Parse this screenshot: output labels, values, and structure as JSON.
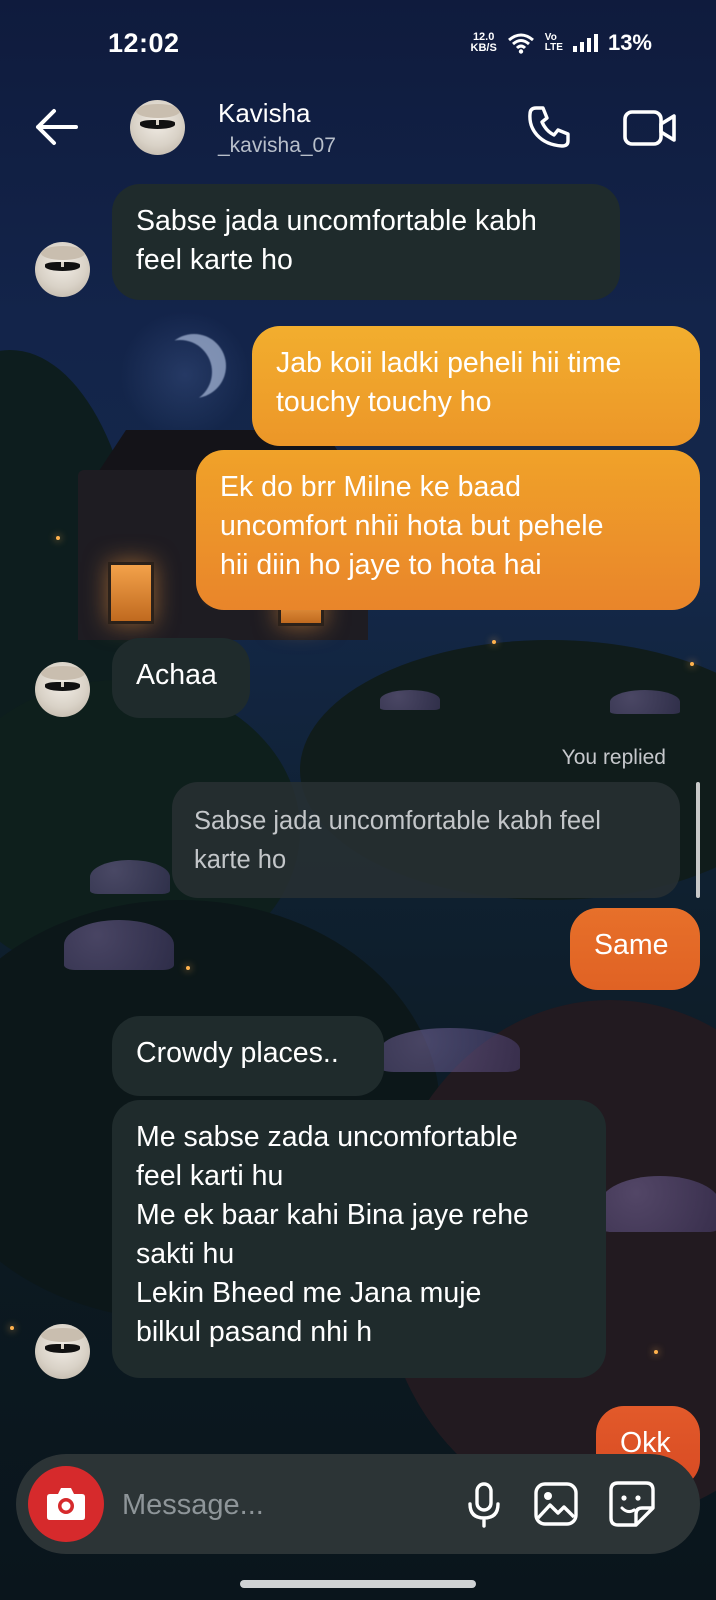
{
  "status_bar": {
    "time": "12:02",
    "net_speed_value": "12.0",
    "net_speed_unit": "KB/S",
    "volte_top": "Vo",
    "volte_bottom": "LTE",
    "battery": "13%"
  },
  "header": {
    "name": "Kavisha",
    "username": "_kavisha_07"
  },
  "messages": [
    {
      "from": "them",
      "text": "Sabse jada uncomfortable kabh\nfeel karte ho"
    },
    {
      "from": "me",
      "text": "Jab koii ladki peheli hii time\ntouchy touchy ho"
    },
    {
      "from": "me",
      "text": "Ek do brr Milne ke baad\nuncomfort nhii hota but pehele\nhii diin ho jaye to  hota hai"
    },
    {
      "from": "them",
      "text": "Achaa"
    },
    {
      "from": "me",
      "text": "Same"
    },
    {
      "from": "them",
      "text": "Crowdy places.."
    },
    {
      "from": "them",
      "text": "Me sabse zada uncomfortable\nfeel karti hu\nMe ek baar kahi Bina jaye rehe\nsakti hu\nLekin Bheed me Jana muje\nbilkul pasand nhi h"
    },
    {
      "from": "me",
      "text": "Okk"
    }
  ],
  "reply": {
    "label": "You replied",
    "quoted_text": "Sabse jada uncomfortable kabh feel\nkarte ho"
  },
  "composer": {
    "placeholder": "Message..."
  },
  "colors": {
    "incoming_bubble": "#1f2b2c",
    "outgoing_top": "#f2ae2e",
    "outgoing_bottom": "#d84a23",
    "camera_button": "#d62a2c"
  },
  "icons": [
    "back-arrow-icon",
    "phone-icon",
    "video-camera-icon",
    "camera-icon",
    "microphone-icon",
    "gallery-icon",
    "sticker-icon"
  ]
}
